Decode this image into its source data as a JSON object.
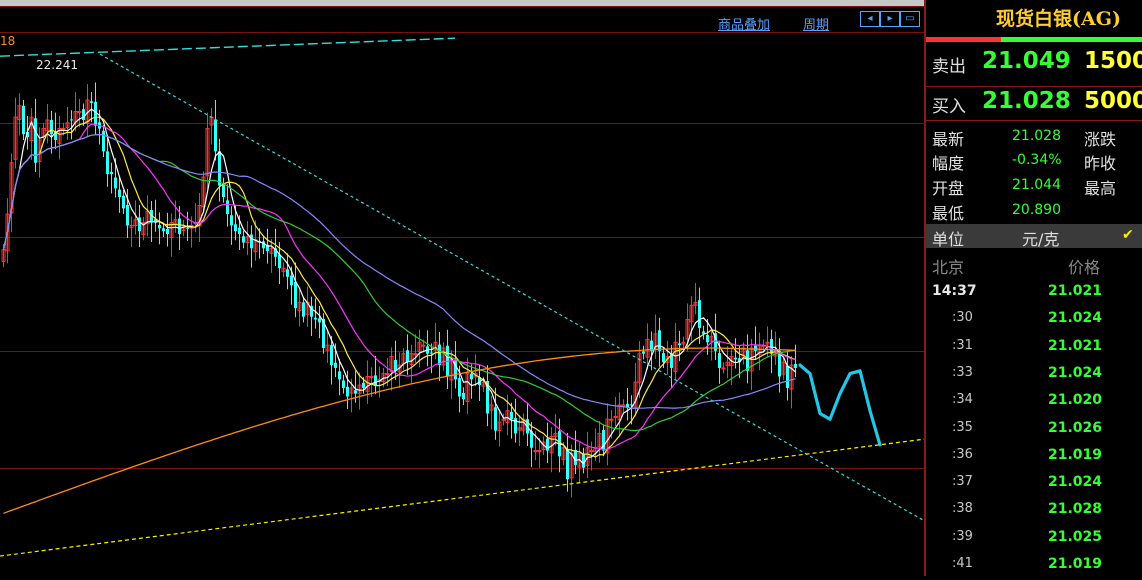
{
  "toolbar": {
    "overlay_label": "商品叠加",
    "period_label": "周期"
  },
  "chart": {
    "corner_label": "18",
    "price_annotation": "22.241",
    "colors": {
      "up": "#ff3333",
      "down": "#33ffff",
      "ma1": "#ffffff",
      "ma2": "#ffee44",
      "ma3": "#ff33ff",
      "ma4": "#33cc33",
      "ma5": "#8888ff",
      "ma6": "#ff8a1a",
      "trend_top": "#33dddd",
      "trend_bottom": "#ffee00",
      "forecast": "#22c8e8"
    }
  },
  "panel": {
    "title": "现货白银(AG)",
    "sell_label": "卖出",
    "sell_price": "21.049",
    "sell_volume": "1500",
    "buy_label": "买入",
    "buy_price": "21.028",
    "buy_volume": "5000",
    "latest_label": "最新",
    "latest_value": "21.028",
    "change_label": "涨跌",
    "range_label": "幅度",
    "range_value": "-0.34%",
    "prev_close_label": "昨收",
    "open_label": "开盘",
    "open_value": "21.044",
    "high_label": "最高",
    "low_label": "最低",
    "low_value": "20.890",
    "unit_label": "单位",
    "unit_value": "元/克",
    "beijing_label": "北京",
    "price_label": "价格",
    "ticks": [
      {
        "time": "14:37",
        "price": "21.021"
      },
      {
        "time": ":30",
        "price": "21.024"
      },
      {
        "time": ":31",
        "price": "21.021"
      },
      {
        "time": ":33",
        "price": "21.024"
      },
      {
        "time": ":34",
        "price": "21.020"
      },
      {
        "time": ":35",
        "price": "21.026"
      },
      {
        "time": ":36",
        "price": "21.019"
      },
      {
        "time": ":37",
        "price": "21.024"
      },
      {
        "time": ":38",
        "price": "21.028"
      },
      {
        "time": ":39",
        "price": "21.025"
      },
      {
        "time": ":41",
        "price": "21.019"
      }
    ]
  },
  "chart_data": {
    "type": "candlestick",
    "title": "",
    "x": [
      1,
      2,
      3,
      4,
      5,
      6,
      7,
      8,
      9,
      10,
      11,
      12,
      13,
      14,
      15,
      16,
      17,
      18,
      19,
      20,
      21,
      22,
      23,
      24,
      25,
      26,
      27,
      28,
      29,
      30,
      31,
      32,
      33,
      34,
      35,
      36,
      37,
      38,
      39,
      40,
      41,
      42,
      43,
      44,
      45,
      46,
      47,
      48,
      49,
      50,
      51,
      52,
      53,
      54,
      55,
      56,
      57,
      58,
      59,
      60,
      61,
      62,
      63,
      64,
      65,
      66,
      67,
      68,
      69,
      70,
      71,
      72,
      73,
      74,
      75,
      76,
      77,
      78,
      79,
      80,
      81,
      82,
      83,
      84,
      85,
      86,
      87,
      88,
      89,
      90,
      91,
      92,
      93,
      94,
      95,
      96,
      97,
      98,
      99,
      100,
      101,
      102,
      103,
      104,
      105,
      106,
      107,
      108,
      109,
      110,
      111,
      112,
      113,
      114,
      115,
      116,
      117,
      118,
      119,
      120,
      121,
      122,
      123,
      124,
      125,
      126,
      127,
      128,
      129,
      130,
      131,
      132,
      133,
      134,
      135,
      136,
      137,
      138,
      139,
      140,
      141,
      142,
      143,
      144,
      145,
      146,
      147,
      148,
      149,
      150,
      151,
      152,
      153,
      154,
      155,
      156,
      157,
      158,
      159,
      160,
      161,
      162,
      163,
      164,
      165,
      166,
      167,
      168,
      169,
      170,
      171,
      172,
      173,
      174,
      175,
      176,
      177,
      178,
      179,
      180,
      181,
      182,
      183,
      184,
      185,
      186,
      187,
      188,
      189,
      190,
      191,
      192,
      193,
      194,
      195,
      196,
      197,
      198,
      199,
      200,
      201,
      202,
      203
    ],
    "close": [
      21.555,
      21.68,
      21.86,
      22.02,
      22.06,
      21.96,
      21.95,
      22.02,
      21.86,
      21.94,
      21.98,
      22.01,
      21.96,
      21.94,
      21.98,
      21.98,
      22.0,
      22.01,
      22.04,
      22.04,
      22.01,
      22.08,
      22.07,
      21.99,
      21.98,
      21.9,
      21.82,
      21.82,
      21.77,
      21.74,
      21.7,
      21.64,
      21.64,
      21.66,
      21.62,
      21.65,
      21.69,
      21.65,
      21.65,
      21.63,
      21.62,
      21.61,
      21.65,
      21.66,
      21.61,
      21.64,
      21.63,
      21.64,
      21.65,
      21.71,
      21.81,
      21.98,
      22.02,
      21.9,
      21.78,
      21.74,
      21.68,
      21.64,
      21.62,
      21.61,
      21.58,
      21.6,
      21.56,
      21.59,
      21.58,
      21.56,
      21.55,
      21.56,
      21.53,
      21.49,
      21.49,
      21.46,
      21.43,
      21.35,
      21.37,
      21.32,
      21.37,
      21.32,
      21.31,
      21.3,
      21.21,
      21.22,
      21.15,
      21.14,
      21.1,
      21.07,
      21.04,
      21.07,
      21.05,
      21.08,
      21.07,
      21.11,
      21.11,
      21.08,
      21.1,
      21.12,
      21.12,
      21.18,
      21.13,
      21.15,
      21.19,
      21.16,
      21.19,
      21.19,
      21.23,
      21.22,
      21.19,
      21.19,
      21.23,
      21.15,
      21.21,
      21.11,
      21.17,
      21.1,
      21.04,
      21.03,
      21.12,
      21.1,
      21.12,
      21.08,
      21.09,
      20.98,
      21.01,
      20.92,
      20.95,
      20.96,
      20.99,
      20.96,
      20.91,
      20.93,
      20.96,
      20.91,
      20.86,
      20.85,
      20.85,
      20.88,
      20.85,
      20.9,
      20.91,
      20.83,
      20.86,
      20.75,
      20.84,
      20.8,
      20.84,
      20.79,
      20.86,
      20.85,
      20.86,
      20.91,
      20.85,
      20.96,
      20.96,
      20.97,
      21.01,
      21.01,
      21.0,
      21.01,
      21.09,
      21.19,
      21.19,
      21.24,
      21.2,
      21.26,
      21.2,
      21.16,
      21.18,
      21.14,
      21.23,
      21.22,
      21.23,
      21.31,
      21.36,
      21.37,
      21.28,
      21.26,
      21.23,
      21.25,
      21.2,
      21.14,
      21.14,
      21.16,
      21.18,
      21.17,
      21.16,
      21.21,
      21.13,
      21.21,
      21.2,
      21.22,
      21.22,
      21.23,
      21.19,
      21.2,
      21.11,
      21.16,
      21.07,
      21.15,
      21.14
    ],
    "forecast_path": [
      21.15,
      21.12,
      20.98,
      20.96,
      21.05,
      21.12,
      21.13,
      20.99,
      20.87
    ],
    "lines": [
      {
        "kind": "trend",
        "x": [
          0,
          230
        ],
        "y": [
          22.241,
          20.85
        ]
      },
      {
        "kind": "trend",
        "x": [
          0,
          230
        ],
        "y": [
          20.48,
          20.89
        ]
      }
    ],
    "price_marker": 22.241,
    "ylim": [
      20.41,
      22.41
    ],
    "grid": true
  }
}
